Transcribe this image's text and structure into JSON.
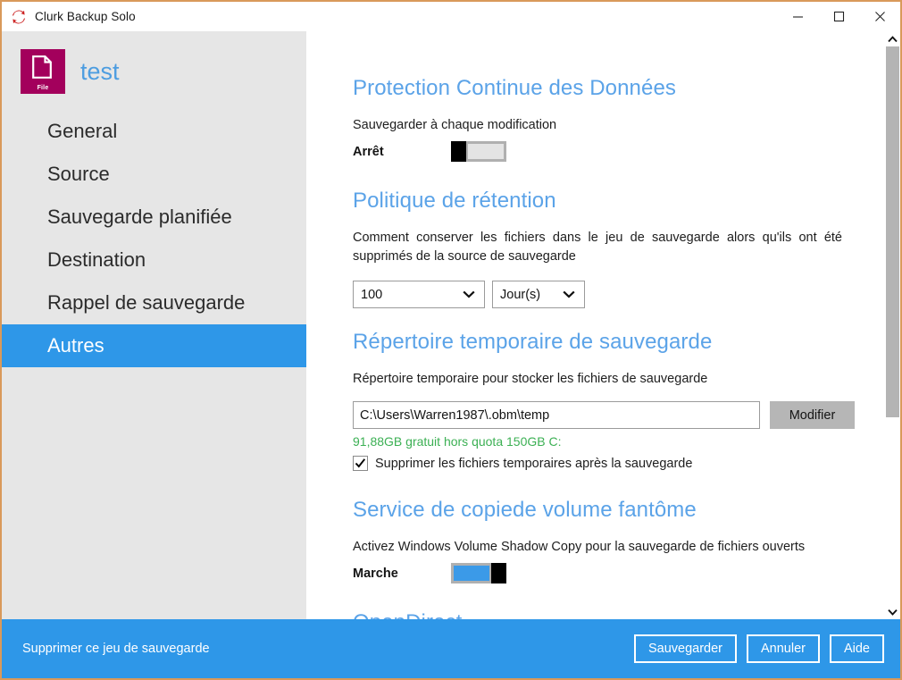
{
  "window": {
    "title": "Clurk Backup Solo",
    "app_icon": "sync-refresh-icon",
    "controls": {
      "minimize": "minimize-icon",
      "maximize": "maximize-icon",
      "close": "close-icon"
    },
    "border_color": "#d9995a"
  },
  "sidebar": {
    "profile": {
      "icon_label": "File",
      "icon_color": "#a3005c",
      "name": "test"
    },
    "items": [
      {
        "label": "General",
        "active": false
      },
      {
        "label": "Source",
        "active": false
      },
      {
        "label": "Sauvegarde planifiée",
        "active": false
      },
      {
        "label": "Destination",
        "active": false
      },
      {
        "label": "Rappel de sauvegarde",
        "active": false
      },
      {
        "label": "Autres",
        "active": true
      }
    ],
    "active_color": "#2e97e8",
    "background": "#e6e6e6"
  },
  "content": {
    "heading_color": "#5ba3e8",
    "sections": [
      {
        "title": "Protection Continue des Données",
        "description": "Sauvegarder à chaque modification",
        "toggle": {
          "label": "Arrêt",
          "state": "off"
        }
      },
      {
        "title": "Politique de rétention",
        "description": "Comment conserver les fichiers dans le jeu de sauvegarde alors qu'ils ont été supprimés de la source de sauvegarde",
        "selects": [
          {
            "name": "retention-count",
            "value": "100"
          },
          {
            "name": "retention-unit",
            "value": "Jour(s)"
          }
        ]
      },
      {
        "title": "Répertoire temporaire de sauvegarde",
        "description": "Répertoire temporaire pour stocker les fichiers de sauvegarde",
        "path_value": "C:\\Users\\Warren1987\\.obm\\temp",
        "path_placeholder": "",
        "modify_button": "Modifier",
        "quota_text": "91,88GB gratuit hors quota 150GB C:",
        "quota_color": "#3cb054",
        "checkbox": {
          "label": "Supprimer les fichiers temporaires après la sauvegarde",
          "checked": true
        }
      },
      {
        "title": "Service de copiede volume fantôme",
        "description": "Activez Windows Volume Shadow Copy pour la sauvegarde de fichiers ouverts",
        "toggle": {
          "label": "Marche",
          "state": "on"
        }
      },
      {
        "title": "OpenDirect"
      }
    ]
  },
  "scrollbar": {
    "up_icon": "chevron-up-icon",
    "down_icon": "chevron-down-icon",
    "thumb_position": "top"
  },
  "footer": {
    "background": "#2e97e8",
    "delete_link": "Supprimer ce jeu de sauvegarde",
    "buttons": [
      {
        "name": "save-button",
        "label": "Sauvegarder"
      },
      {
        "name": "cancel-button",
        "label": "Annuler"
      },
      {
        "name": "help-button",
        "label": "Aide"
      }
    ]
  }
}
